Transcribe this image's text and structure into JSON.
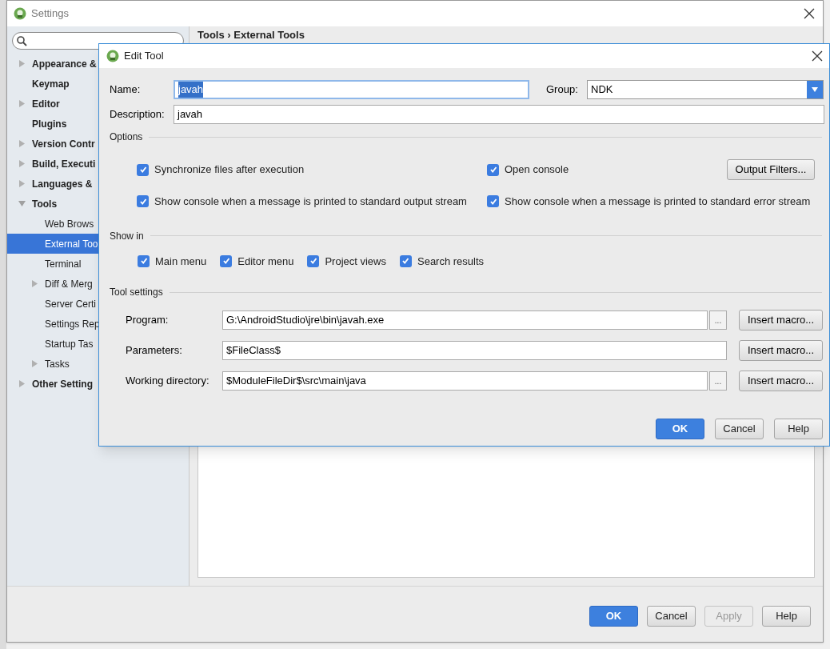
{
  "settings": {
    "title": "Settings",
    "breadcrumb": "Tools › External Tools",
    "tree": [
      {
        "label": "Appearance &",
        "expanded": false,
        "selected": false
      },
      {
        "label": "Keymap",
        "selected": false
      },
      {
        "label": "Editor",
        "expanded": false,
        "selected": false
      },
      {
        "label": "Plugins",
        "selected": false
      },
      {
        "label": "Version Contr",
        "expanded": false,
        "selected": false
      },
      {
        "label": "Build, Executi",
        "expanded": false,
        "selected": false
      },
      {
        "label": "Languages &",
        "expanded": false,
        "selected": false
      },
      {
        "label": "Tools",
        "expanded": true,
        "selected": false,
        "children": [
          {
            "label": "Web Brows",
            "selected": false
          },
          {
            "label": "External Too",
            "selected": true
          },
          {
            "label": "Terminal",
            "selected": false
          },
          {
            "label": "Diff & Merg",
            "expanded": false,
            "selected": false
          },
          {
            "label": "Server Certi",
            "selected": false
          },
          {
            "label": "Settings Rep",
            "selected": false
          },
          {
            "label": "Startup Tas",
            "selected": false
          },
          {
            "label": "Tasks",
            "expanded": false,
            "selected": false
          }
        ]
      },
      {
        "label": "Other Setting",
        "expanded": false,
        "selected": false
      }
    ],
    "buttons": [
      {
        "label": "OK",
        "kind": "primary",
        "disabled": false
      },
      {
        "label": "Cancel",
        "kind": "normal",
        "disabled": false
      },
      {
        "label": "Apply",
        "kind": "normal",
        "disabled": true
      },
      {
        "label": "Help",
        "kind": "normal",
        "disabled": false
      }
    ]
  },
  "dialog": {
    "title": "Edit Tool",
    "name": {
      "label": "Name:",
      "value": "javah",
      "text_selected": true,
      "focused": true
    },
    "group": {
      "label": "Group:",
      "value": "NDK"
    },
    "description": {
      "label": "Description:",
      "value": "javah"
    },
    "options": {
      "title": "Options",
      "checks": [
        {
          "label": "Synchronize files after execution",
          "checked": true
        },
        {
          "label": "Open console",
          "checked": true
        },
        {
          "label": "Show console when a message is printed to standard output stream",
          "checked": true
        },
        {
          "label": "Show console when a message is printed to standard error stream",
          "checked": true
        }
      ],
      "filters_button": "Output Filters..."
    },
    "show_in": {
      "title": "Show in",
      "checks": [
        {
          "label": "Main menu",
          "checked": true
        },
        {
          "label": "Editor menu",
          "checked": true
        },
        {
          "label": "Project views",
          "checked": true
        },
        {
          "label": "Search results",
          "checked": true
        }
      ]
    },
    "tool_settings": {
      "title": "Tool settings",
      "rows": [
        {
          "label": "Program:",
          "value": "G:\\AndroidStudio\\jre\\bin\\javah.exe",
          "browse": "...",
          "macro": "Insert macro..."
        },
        {
          "label": "Parameters:",
          "value": "$FileClass$",
          "macro": "Insert macro..."
        },
        {
          "label": "Working directory:",
          "value": "$ModuleFileDir$\\src\\main\\java",
          "browse": "...",
          "macro": "Insert macro..."
        }
      ]
    },
    "buttons": [
      {
        "label": "OK",
        "kind": "primary"
      },
      {
        "label": "Cancel",
        "kind": "normal"
      },
      {
        "label": "Help",
        "kind": "normal"
      }
    ]
  }
}
